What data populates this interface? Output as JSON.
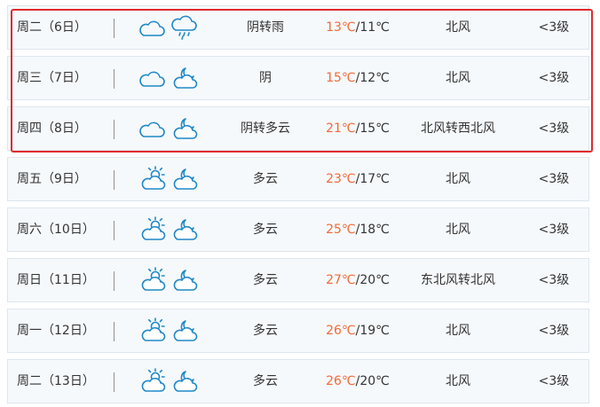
{
  "colors": {
    "high_temp": "#f26a36",
    "highlight_border": "#e0292d",
    "icon_stroke": "#1f88c7"
  },
  "days": [
    {
      "date": "周二（6日）",
      "day_icon": "cloudy-icon",
      "night_icon": "rain-icon",
      "desc": "阴转雨",
      "high": "13℃",
      "low": "/11℃",
      "wind": "北风",
      "level": "<3级"
    },
    {
      "date": "周三（7日）",
      "day_icon": "cloudy-icon",
      "night_icon": "partly-cloudy-night-icon",
      "desc": "阴",
      "high": "15℃",
      "low": "/12℃",
      "wind": "北风",
      "level": "<3级"
    },
    {
      "date": "周四（8日）",
      "day_icon": "cloudy-icon",
      "night_icon": "partly-cloudy-night-icon",
      "desc": "阴转多云",
      "high": "21℃",
      "low": "/15℃",
      "wind": "北风转西北风",
      "level": "<3级"
    },
    {
      "date": "周五（9日）",
      "day_icon": "partly-cloudy-day-icon",
      "night_icon": "partly-cloudy-night-icon",
      "desc": "多云",
      "high": "23℃",
      "low": "/17℃",
      "wind": "北风",
      "level": "<3级"
    },
    {
      "date": "周六（10日）",
      "day_icon": "partly-cloudy-day-icon",
      "night_icon": "partly-cloudy-night-icon",
      "desc": "多云",
      "high": "25℃",
      "low": "/18℃",
      "wind": "北风",
      "level": "<3级"
    },
    {
      "date": "周日（11日）",
      "day_icon": "partly-cloudy-day-icon",
      "night_icon": "partly-cloudy-night-icon",
      "desc": "多云",
      "high": "27℃",
      "low": "/20℃",
      "wind": "东北风转北风",
      "level": "<3级"
    },
    {
      "date": "周一（12日）",
      "day_icon": "partly-cloudy-day-icon",
      "night_icon": "partly-cloudy-night-icon",
      "desc": "多云",
      "high": "26℃",
      "low": "/19℃",
      "wind": "北风",
      "level": "<3级"
    },
    {
      "date": "周二（13日）",
      "day_icon": "partly-cloudy-day-icon",
      "night_icon": "partly-cloudy-night-icon",
      "desc": "多云",
      "high": "26℃",
      "low": "/20℃",
      "wind": "北风",
      "level": "<3级"
    }
  ]
}
